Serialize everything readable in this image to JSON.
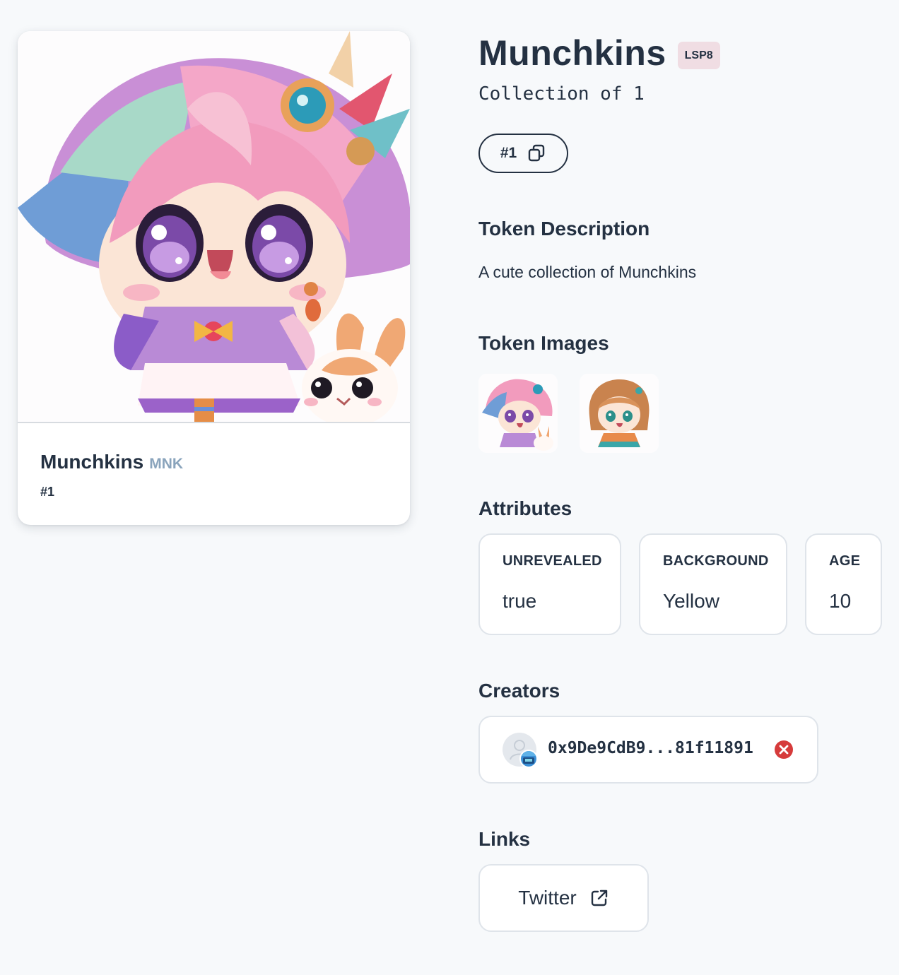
{
  "card": {
    "name": "Munchkins",
    "symbol": "MNK",
    "token_id": "#1",
    "image_alt": "Chibi anime girl with pastel rainbow hair and a bunny"
  },
  "header": {
    "title": "Munchkins",
    "standard_badge": "LSP8",
    "subtitle": "Collection of 1",
    "token_pill": "#1",
    "copy_icon": "copy-icon"
  },
  "description": {
    "heading": "Token Description",
    "text": "A cute collection of Munchkins"
  },
  "images": {
    "heading": "Token Images",
    "thumbs": [
      "thumbnail-rainbow-girl",
      "thumbnail-brown-girl"
    ]
  },
  "attributes": {
    "heading": "Attributes",
    "items": [
      {
        "key": "UNREVEALED",
        "value": "true"
      },
      {
        "key": "BACKGROUND",
        "value": "Yellow"
      },
      {
        "key": "AGE",
        "value": "10"
      }
    ]
  },
  "creators": {
    "heading": "Creators",
    "items": [
      {
        "address": "0x9De9CdB9...81f11891",
        "status_icon": "error-x-icon",
        "status_color": "#d63b3b"
      }
    ]
  },
  "links": {
    "heading": "Links",
    "items": [
      {
        "label": "Twitter",
        "icon": "external-link-icon"
      }
    ]
  },
  "colors": {
    "background": "#f7f9fb",
    "text": "#243142",
    "badge_bg": "#f0dde3",
    "symbol": "#8aa4bc",
    "border": "#dfe4ea"
  }
}
